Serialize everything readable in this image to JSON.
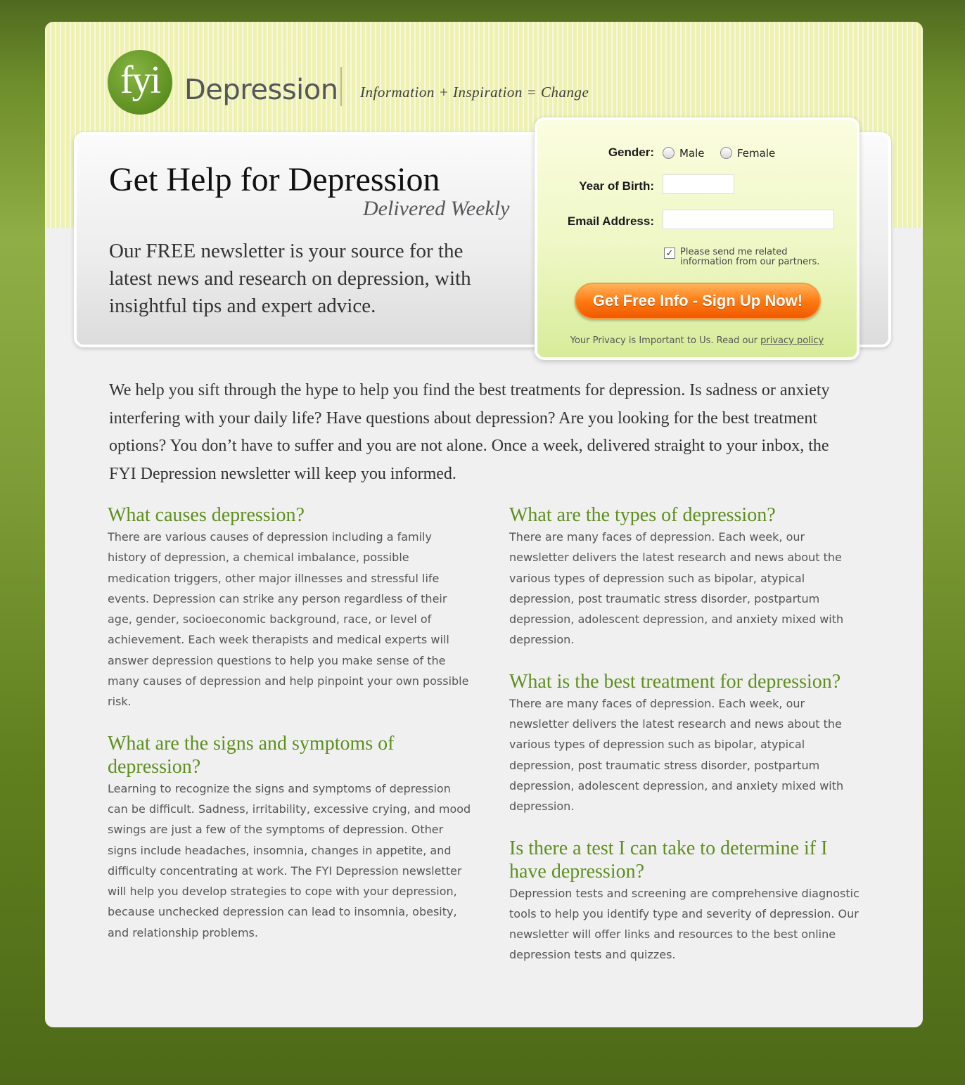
{
  "header": {
    "logo_text": "fyi",
    "brand_name": "Depression",
    "tagline": "Information + Inspiration = Change"
  },
  "hero": {
    "title": "Get Help for Depression",
    "subtitle": "Delivered Weekly",
    "description": "Our FREE newsletter is your source for the latest news and research on depression, with insightful tips and expert advice."
  },
  "form": {
    "gender_label": "Gender:",
    "gender_options": [
      "Male",
      "Female"
    ],
    "year_label": "Year of Birth:",
    "year_value": "",
    "email_label": "Email Address:",
    "email_value": "",
    "partners_checkbox_checked": true,
    "partners_label": "Please send me related information from our partners.",
    "submit_label": "Get Free Info - Sign Up Now!",
    "privacy_text": "Your Privacy is Important to Us. Read our",
    "privacy_link": "privacy policy",
    "accent_color": "#ff7a12"
  },
  "intro": "We help you sift through the hype to help you find the best treatments for depression. Is sadness or anxiety interfering with your daily life? Have questions about depression? Are you looking for the best treatment options? You don’t have to suffer and you are not alone. Once a week, delivered straight to your inbox, the FYI Depression newsletter will keep you informed.",
  "sections_left": [
    {
      "heading": "What causes depression?",
      "body": "There are various causes of depression including a family history of depression, a chemical imbalance, possible medication triggers, other major illnesses and stressful life events. Depression can strike any person regardless of their age, gender, socioeconomic background, race, or level of achievement. Each week therapists and medical experts will answer  depression questions to help you make sense of the many causes of depression and help pinpoint your own possible risk."
    },
    {
      "heading": "What are the signs and symptoms of depression?",
      "body": "Learning to recognize the signs and symptoms of depression can be difficult. Sadness, irritability, excessive crying, and mood swings are just a few of the symptoms of depression. Other signs include headaches, insomnia, changes in appetite, and difficulty concentrating at work. The FYI Depression newsletter will help you develop strategies to cope with your depression, because unchecked depression can lead to insomnia, obesity, and relationship problems."
    }
  ],
  "sections_right": [
    {
      "heading": "What are the types of depression?",
      "body": "There are many faces of depression. Each week, our newsletter delivers the latest research and news about the various types of depression such as bipolar, atypical depression, post traumatic stress disorder, postpartum depression, adolescent depression, and anxiety mixed with depression."
    },
    {
      "heading": "What is the best treatment for depression?",
      "body": "There are many faces of depression. Each week, our newsletter delivers the latest research and news about the various types of depression such as bipolar, atypical depression, post traumatic stress disorder, postpartum depression, adolescent depression, and anxiety mixed with depression."
    },
    {
      "heading": "Is there a test I can take to determine if I have depression?",
      "body": "Depression tests and screening are comprehensive diagnostic tools to help you identify type and severity of depression. Our newsletter will offer links and resources to the best online depression tests and quizzes."
    }
  ]
}
